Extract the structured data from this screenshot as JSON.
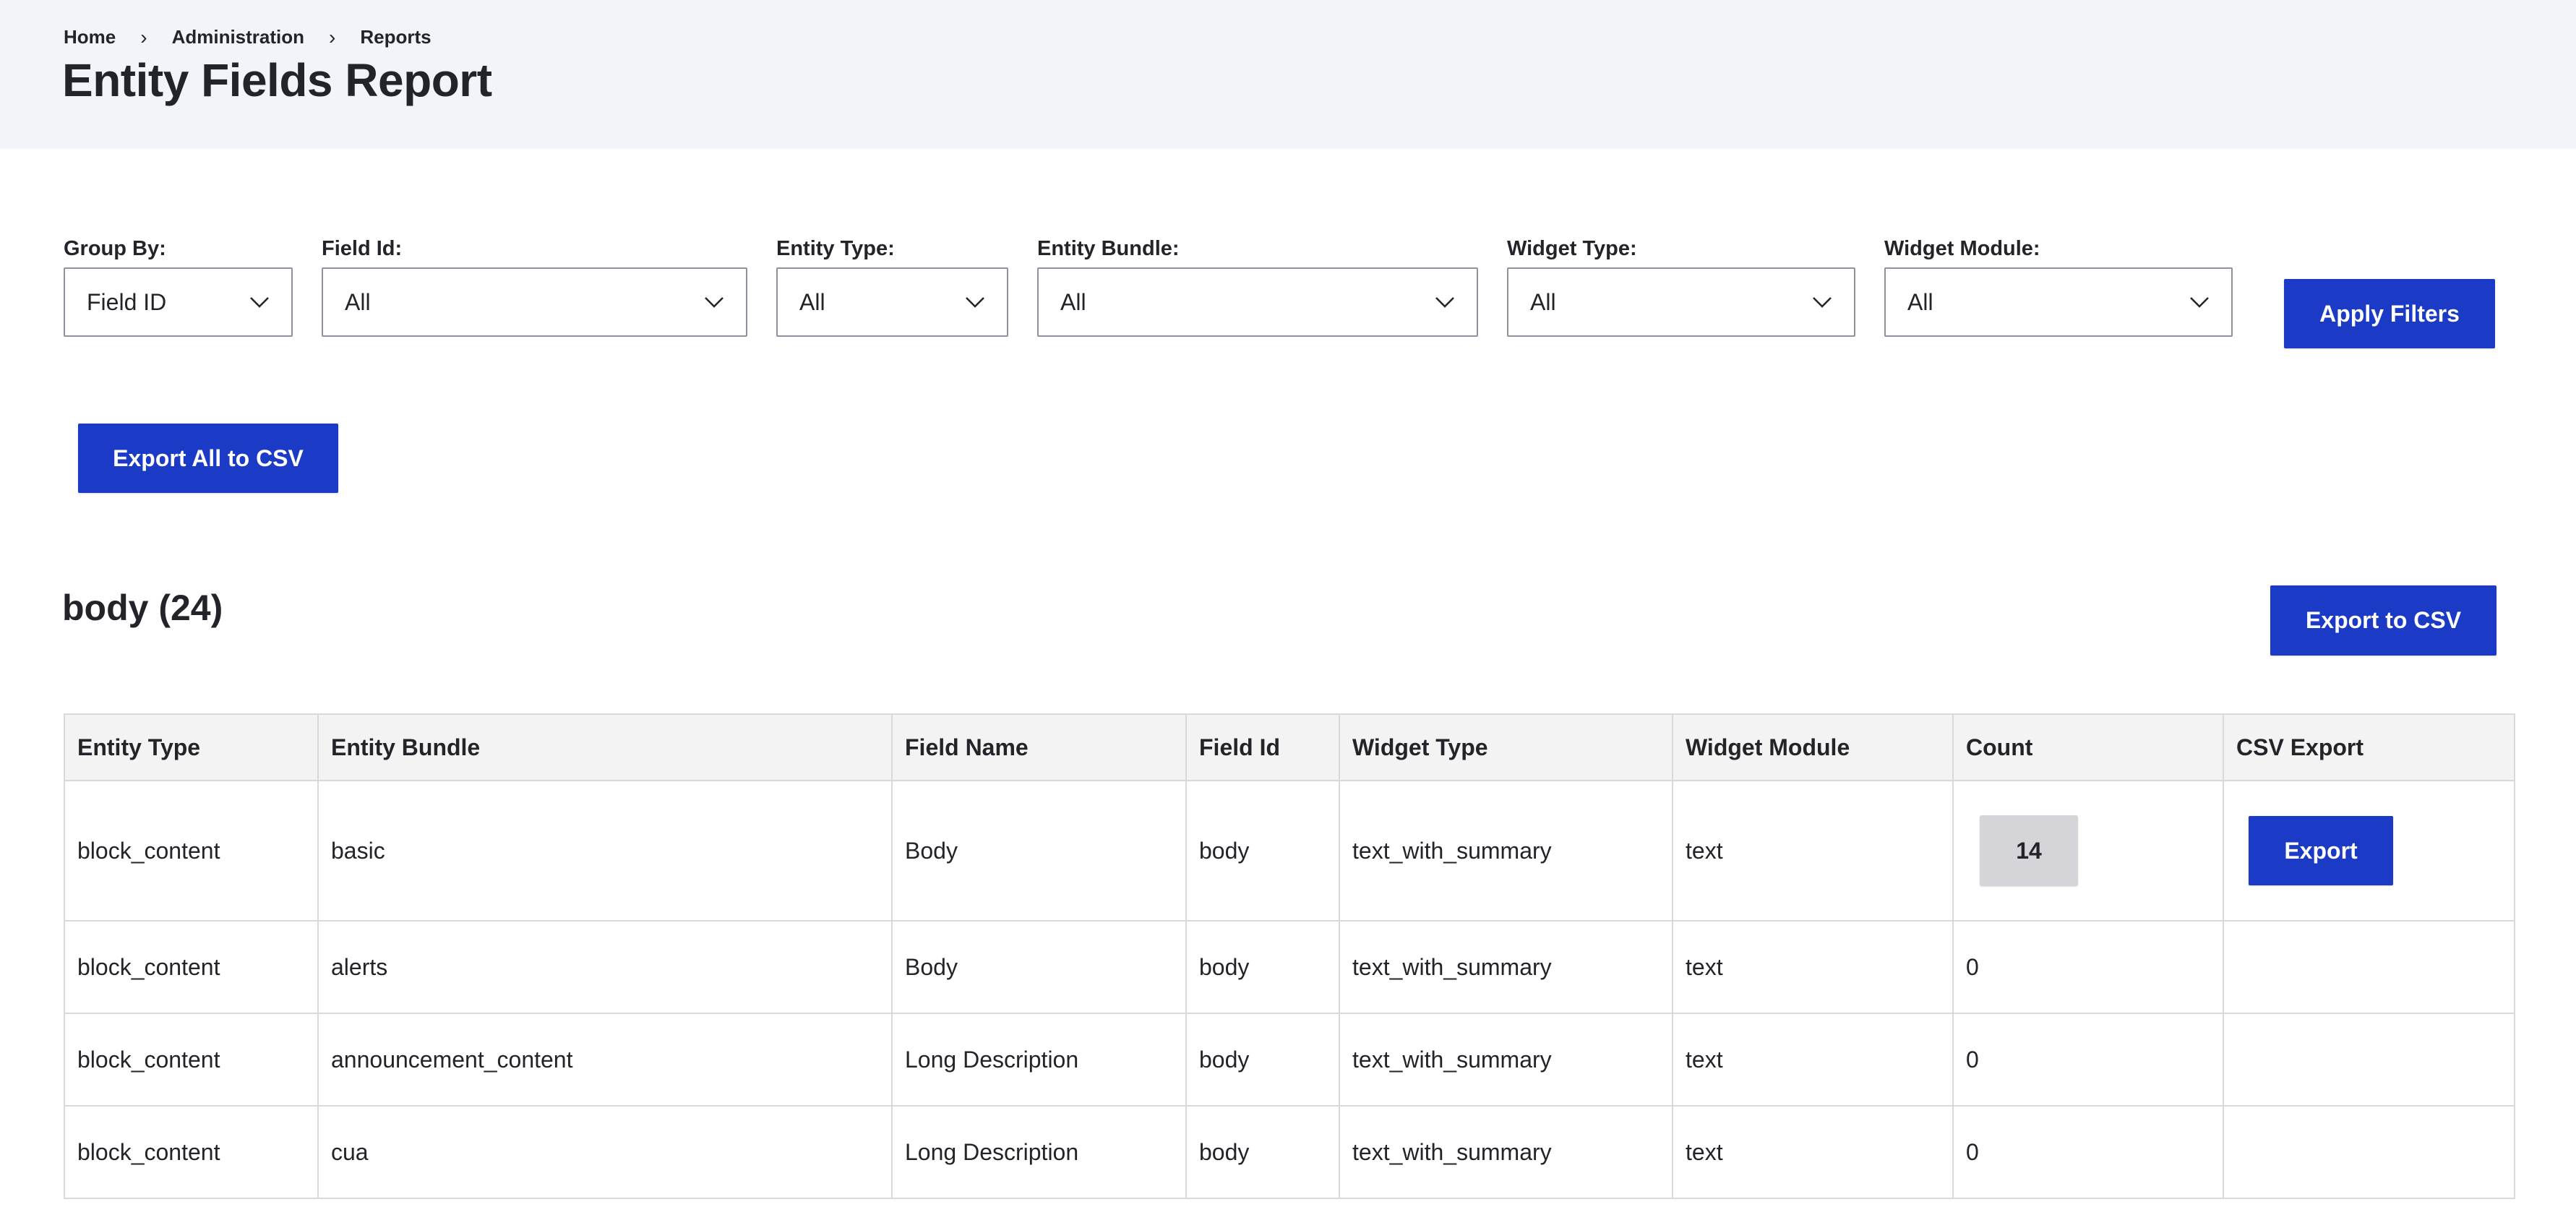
{
  "breadcrumb": {
    "items": [
      "Home",
      "Administration",
      "Reports"
    ],
    "separator": "›"
  },
  "page": {
    "title": "Entity Fields Report"
  },
  "filters": {
    "group_by": {
      "label": "Group By:",
      "value": "Field ID"
    },
    "field_id": {
      "label": "Field Id:",
      "value": "All"
    },
    "entity_type": {
      "label": "Entity Type:",
      "value": "All"
    },
    "entity_bundle": {
      "label": "Entity Bundle:",
      "value": "All"
    },
    "widget_type": {
      "label": "Widget Type:",
      "value": "All"
    },
    "widget_module": {
      "label": "Widget Module:",
      "value": "All"
    },
    "apply_label": "Apply Filters"
  },
  "actions": {
    "export_all_label": "Export All to CSV"
  },
  "group": {
    "heading": "body (24)",
    "export_label": "Export to CSV"
  },
  "table": {
    "headers": [
      "Entity Type",
      "Entity Bundle",
      "Field Name",
      "Field Id",
      "Widget Type",
      "Widget Module",
      "Count",
      "CSV Export"
    ],
    "rows": [
      {
        "entity_type": "block_content",
        "entity_bundle": "basic",
        "field_name": "Body",
        "field_id": "body",
        "widget_type": "text_with_summary",
        "widget_module": "text",
        "count": "14",
        "export_label": "Export"
      },
      {
        "entity_type": "block_content",
        "entity_bundle": "alerts",
        "field_name": "Body",
        "field_id": "body",
        "widget_type": "text_with_summary",
        "widget_module": "text",
        "count": "0"
      },
      {
        "entity_type": "block_content",
        "entity_bundle": "announcement_content",
        "field_name": "Long Description",
        "field_id": "body",
        "widget_type": "text_with_summary",
        "widget_module": "text",
        "count": "0"
      },
      {
        "entity_type": "block_content",
        "entity_bundle": "cua",
        "field_name": "Long Description",
        "field_id": "body",
        "widget_type": "text_with_summary",
        "widget_module": "text",
        "count": "0"
      }
    ]
  },
  "colors": {
    "primary_button": "#1b3ac6",
    "header_background": "#f3f4f9",
    "table_header_background": "#f3f3f3",
    "count_badge_background": "#d5d5d9"
  },
  "icons": {
    "select_arrow": "chevron-down-icon",
    "breadcrumb_separator": "chevron-right-icon"
  }
}
